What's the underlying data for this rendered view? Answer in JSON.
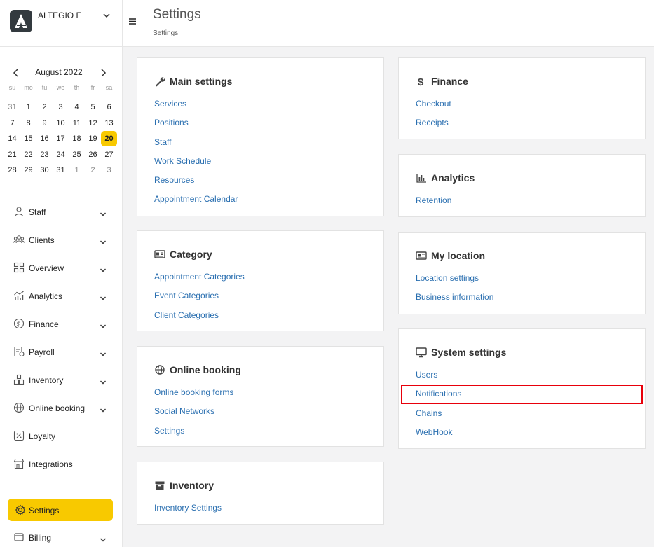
{
  "brand": {
    "name": "ALTEGIO E"
  },
  "calendar": {
    "title": "August 2022",
    "weekdays": [
      "su",
      "mo",
      "tu",
      "we",
      "th",
      "fr",
      "sa"
    ],
    "weeks": [
      [
        "31",
        "1",
        "2",
        "3",
        "4",
        "5",
        "6"
      ],
      [
        "7",
        "8",
        "9",
        "10",
        "11",
        "12",
        "13"
      ],
      [
        "14",
        "15",
        "16",
        "17",
        "18",
        "19",
        "20"
      ],
      [
        "21",
        "22",
        "23",
        "24",
        "25",
        "26",
        "27"
      ],
      [
        "28",
        "29",
        "30",
        "31",
        "1",
        "2",
        "3"
      ]
    ],
    "today": "20"
  },
  "sidebar": {
    "items": [
      {
        "label": "Staff",
        "icon": "user-icon"
      },
      {
        "label": "Clients",
        "icon": "clients-icon"
      },
      {
        "label": "Overview",
        "icon": "grid-icon"
      },
      {
        "label": "Analytics",
        "icon": "analytics-icon"
      },
      {
        "label": "Finance",
        "icon": "dollar-circle-icon"
      },
      {
        "label": "Payroll",
        "icon": "payroll-icon"
      },
      {
        "label": "Inventory",
        "icon": "inventory-icon"
      },
      {
        "label": "Online booking",
        "icon": "globe-icon"
      },
      {
        "label": "Loyalty",
        "icon": "percent-icon"
      },
      {
        "label": "Integrations",
        "icon": "store-icon"
      }
    ],
    "settings_label": "Settings",
    "billing_label": "Billing"
  },
  "header": {
    "title": "Settings",
    "breadcrumb": "Settings"
  },
  "cards": {
    "main": {
      "title": "Main settings",
      "links": [
        "Services",
        "Positions",
        "Staff",
        "Work Schedule",
        "Resources",
        "Appointment Calendar"
      ]
    },
    "category": {
      "title": "Category",
      "links": [
        "Appointment Categories",
        "Event Categories",
        "Client Categories"
      ]
    },
    "online": {
      "title": "Online booking",
      "links": [
        "Online booking forms",
        "Social Networks",
        "Settings"
      ]
    },
    "inventory": {
      "title": "Inventory",
      "links": [
        "Inventory Settings"
      ]
    },
    "finance": {
      "title": "Finance",
      "links": [
        "Checkout",
        "Receipts"
      ]
    },
    "analytics": {
      "title": "Analytics",
      "links": [
        "Retention"
      ]
    },
    "location": {
      "title": "My location",
      "links": [
        "Location settings",
        "Business information"
      ]
    },
    "system": {
      "title": "System settings",
      "links": [
        "Users",
        "Notifications",
        "Chains",
        "WebHook"
      ]
    }
  },
  "colors": {
    "accent": "#f8c900",
    "link": "#2a6fb0",
    "highlight": "#e8000b"
  }
}
